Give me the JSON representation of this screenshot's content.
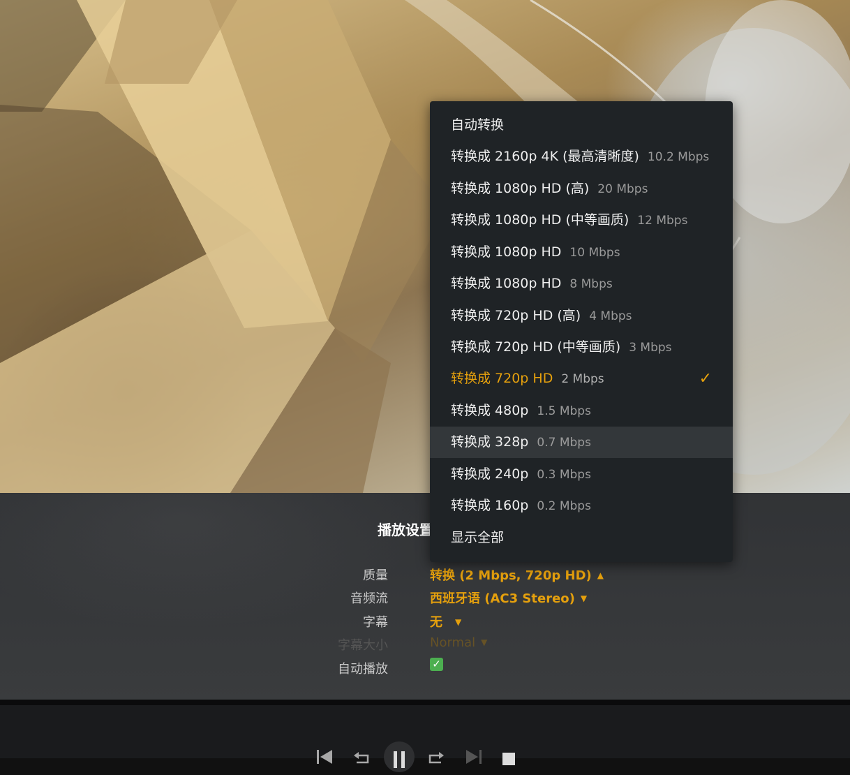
{
  "settings": {
    "title": "播放设置",
    "rows": [
      {
        "label": "质量",
        "value": "转换 (2 Mbps, 720p HD)",
        "caret": "▲"
      },
      {
        "label": "音频流",
        "value": "西班牙语 (AC3 Stereo)",
        "caret": "▼"
      },
      {
        "label": "字幕",
        "value": "无",
        "caret": "▼"
      },
      {
        "label": "字幕大小",
        "value": "Normal",
        "caret": "▼",
        "disabled": true
      },
      {
        "label": "自动播放",
        "checked": true
      }
    ]
  },
  "quality_menu": {
    "options": [
      {
        "label": "自动转换",
        "rate": ""
      },
      {
        "label": "转换成 2160p 4K (最高清晰度)",
        "rate": "10.2 Mbps"
      },
      {
        "label": "转换成 1080p HD (高)",
        "rate": "20 Mbps"
      },
      {
        "label": "转换成 1080p HD (中等画质)",
        "rate": "12 Mbps"
      },
      {
        "label": "转换成 1080p HD",
        "rate": "10 Mbps"
      },
      {
        "label": "转换成 1080p HD",
        "rate": "8 Mbps"
      },
      {
        "label": "转换成 720p HD (高)",
        "rate": "4 Mbps"
      },
      {
        "label": "转换成 720p HD (中等画质)",
        "rate": "3 Mbps"
      },
      {
        "label": "转换成 720p HD",
        "rate": "2 Mbps",
        "selected": true
      },
      {
        "label": "转换成 480p",
        "rate": "1.5 Mbps"
      },
      {
        "label": "转换成 328p",
        "rate": "0.7 Mbps",
        "hovered": true
      },
      {
        "label": "转换成 240p",
        "rate": "0.3 Mbps"
      },
      {
        "label": "转换成 160p",
        "rate": "0.2 Mbps"
      },
      {
        "label": "显示全部",
        "rate": ""
      }
    ],
    "check_glyph": "✓"
  },
  "checkbox_glyph": "✓",
  "controls": [
    {
      "name": "skip-previous-icon"
    },
    {
      "name": "replay-icon"
    },
    {
      "name": "pause-icon"
    },
    {
      "name": "forward-icon"
    },
    {
      "name": "skip-next-icon"
    },
    {
      "name": "stop-icon"
    }
  ],
  "colors": {
    "accent": "#e5a00d",
    "menu_bg": "#1f2326",
    "menu_hover": "#33373a",
    "checkbox": "#4caf50"
  }
}
